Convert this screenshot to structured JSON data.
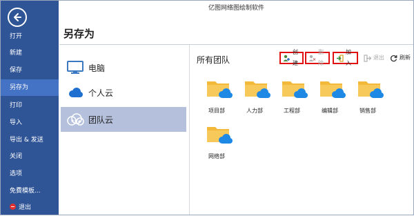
{
  "window": {
    "title": "亿图网络图绘制软件"
  },
  "sidebar": {
    "back_icon": "back-arrow-icon",
    "items": [
      {
        "label": "打开"
      },
      {
        "label": "新建"
      },
      {
        "label": "保存"
      },
      {
        "label": "另存为",
        "active": true
      },
      {
        "label": "打印"
      },
      {
        "label": "导入"
      },
      {
        "label": "导出 & 发送"
      },
      {
        "label": "关闭"
      },
      {
        "label": "选项"
      },
      {
        "label": "免費模板..."
      },
      {
        "label": "退出",
        "icon": "exit-icon"
      }
    ]
  },
  "page": {
    "title": "另存为"
  },
  "locations": [
    {
      "label": "电脑",
      "icon": "monitor-icon"
    },
    {
      "label": "个人云",
      "icon": "cloud-icon"
    },
    {
      "label": "团队云",
      "icon": "team-cloud-icon",
      "active": true
    }
  ],
  "team_panel": {
    "title": "所有团队",
    "toolbar": {
      "create": "创建",
      "delete": "删除",
      "join": "加入",
      "leave": "退出",
      "refresh": "刷新"
    },
    "folders": [
      {
        "label": "项目部"
      },
      {
        "label": "人力部"
      },
      {
        "label": "工程部"
      },
      {
        "label": "编辑部"
      },
      {
        "label": "销售部"
      },
      {
        "label": "网络部"
      }
    ]
  },
  "colors": {
    "sidebar": "#2f5597",
    "sidebar_active": "#4472c4",
    "location_active": "#b4c0dc",
    "folder": "#f5c04a",
    "cloud": "#1e88e5",
    "highlight_box": "#e01010"
  }
}
